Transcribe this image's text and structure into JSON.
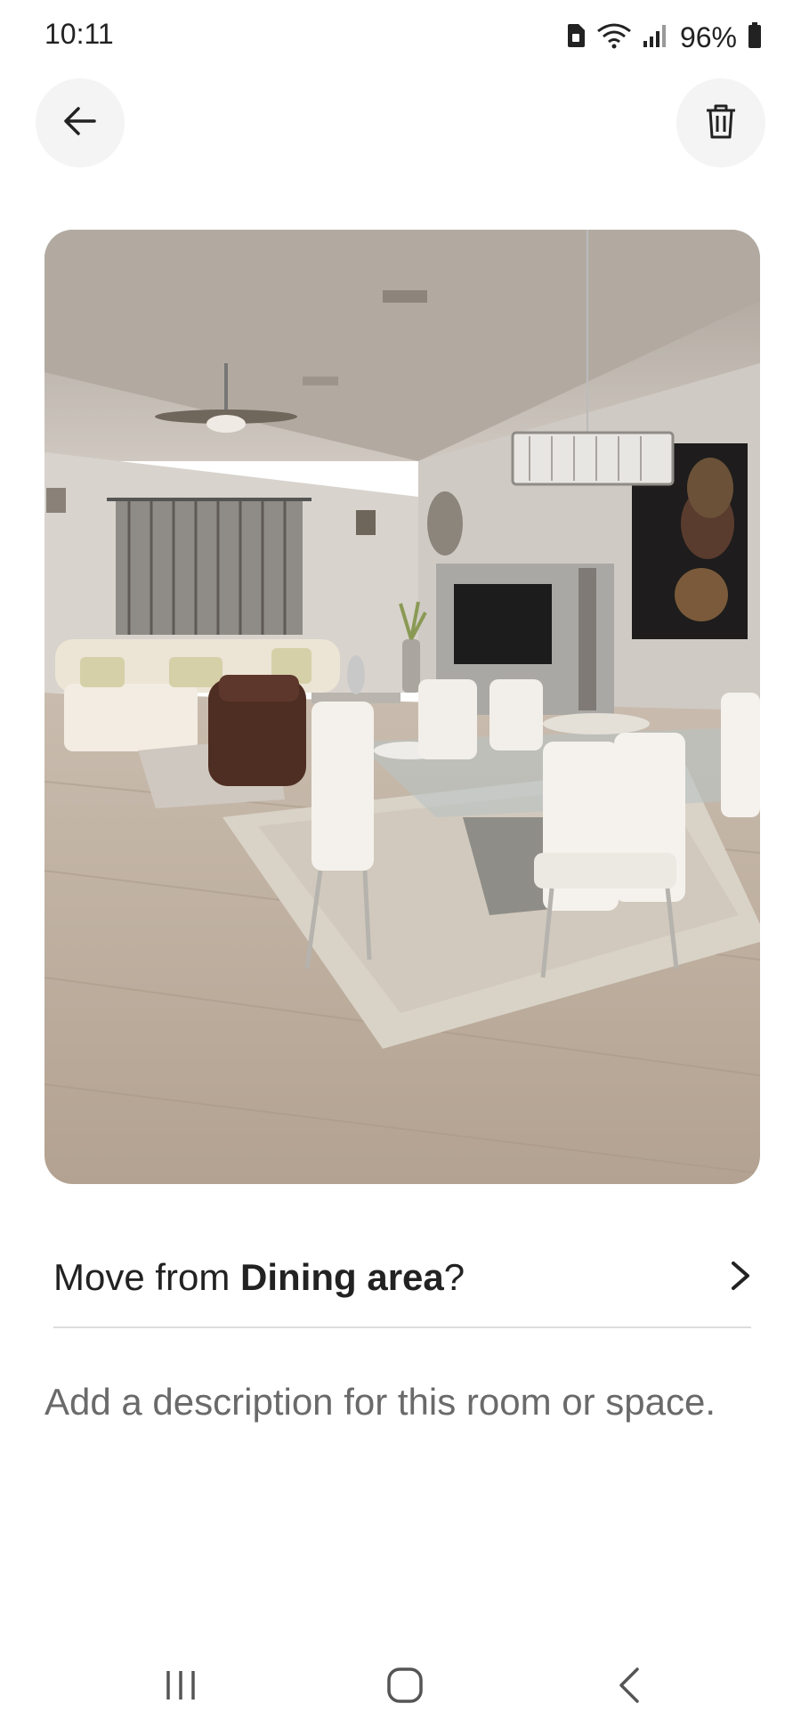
{
  "status_bar": {
    "time": "10:11",
    "battery_percent": "96%",
    "icons": [
      "sim-card-icon",
      "wifi-icon",
      "signal-icon",
      "battery-icon"
    ]
  },
  "header": {
    "back_icon": "arrow-left-icon",
    "delete_icon": "trash-icon"
  },
  "photo": {
    "subject": "room-photo"
  },
  "move_row": {
    "prefix": "Move from ",
    "room": "Dining area",
    "suffix": "?",
    "icon": "chevron-right-icon"
  },
  "description": {
    "placeholder": "Add a description for this room or space."
  },
  "nav_bar": {
    "icons": [
      "recent-apps-icon",
      "home-icon",
      "nav-back-icon"
    ]
  },
  "colors": {
    "text": "#222222",
    "muted_text": "#6a6a6a",
    "divider": "#dddddd",
    "button_bg": "#f4f4f4"
  }
}
